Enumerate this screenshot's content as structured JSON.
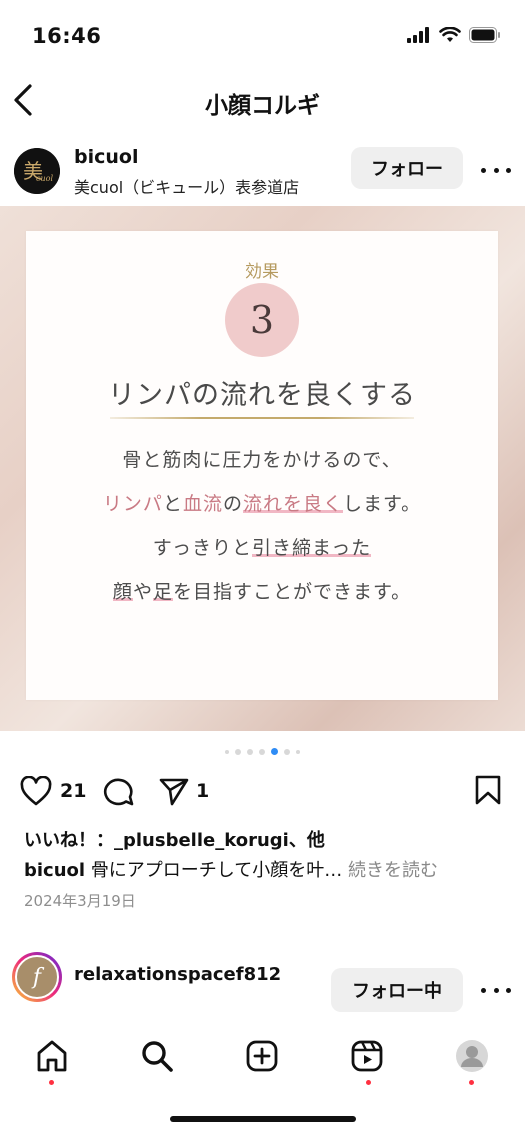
{
  "status_bar": {
    "time": "16:46"
  },
  "header": {
    "title": "小顔コルギ"
  },
  "post": {
    "username": "bicuol",
    "location": "美cuol（ビキュール）表参道店",
    "follow_label": "フォロー",
    "image": {
      "effect_label": "効果",
      "effect_number": "3",
      "heading": "リンパの流れを良くする",
      "line1": "骨と筋肉に圧力をかけるので、",
      "line2_part1": "リンパ",
      "line2_part2": "と",
      "line2_part3": "血流",
      "line2_part4": "の",
      "line2_part5": "流れを良く",
      "line2_part6": "します。",
      "line3_part1": "すっきりと",
      "line3_part2": "引き締まった",
      "line4_part1": "顔",
      "line4_part2": "や",
      "line4_part3": "足",
      "line4_part4": "を目指すことができます。",
      "highlight_color": "#f1b7c4",
      "pink_color": "#c97a84",
      "gold_color": "#c4aa6c"
    },
    "carousel": {
      "total": 7,
      "active_index": 4
    },
    "likes_count": "21",
    "shares_count": "1",
    "likes_line": "いいね！：_plusbelle_korugi、他",
    "caption_user": "bicuol",
    "caption_text": "骨にアプローチして小顔を叶…",
    "read_more": "続きを読む",
    "date": "2024年3月19日"
  },
  "next_post": {
    "username": "relaxationspacef812",
    "follow_label": "フォロー中",
    "avatar_letter": "f"
  },
  "tabbar": {
    "items": [
      "home-icon",
      "search-icon",
      "create-icon",
      "reels-icon",
      "profile-icon"
    ],
    "notification_color": "#ff3040"
  }
}
